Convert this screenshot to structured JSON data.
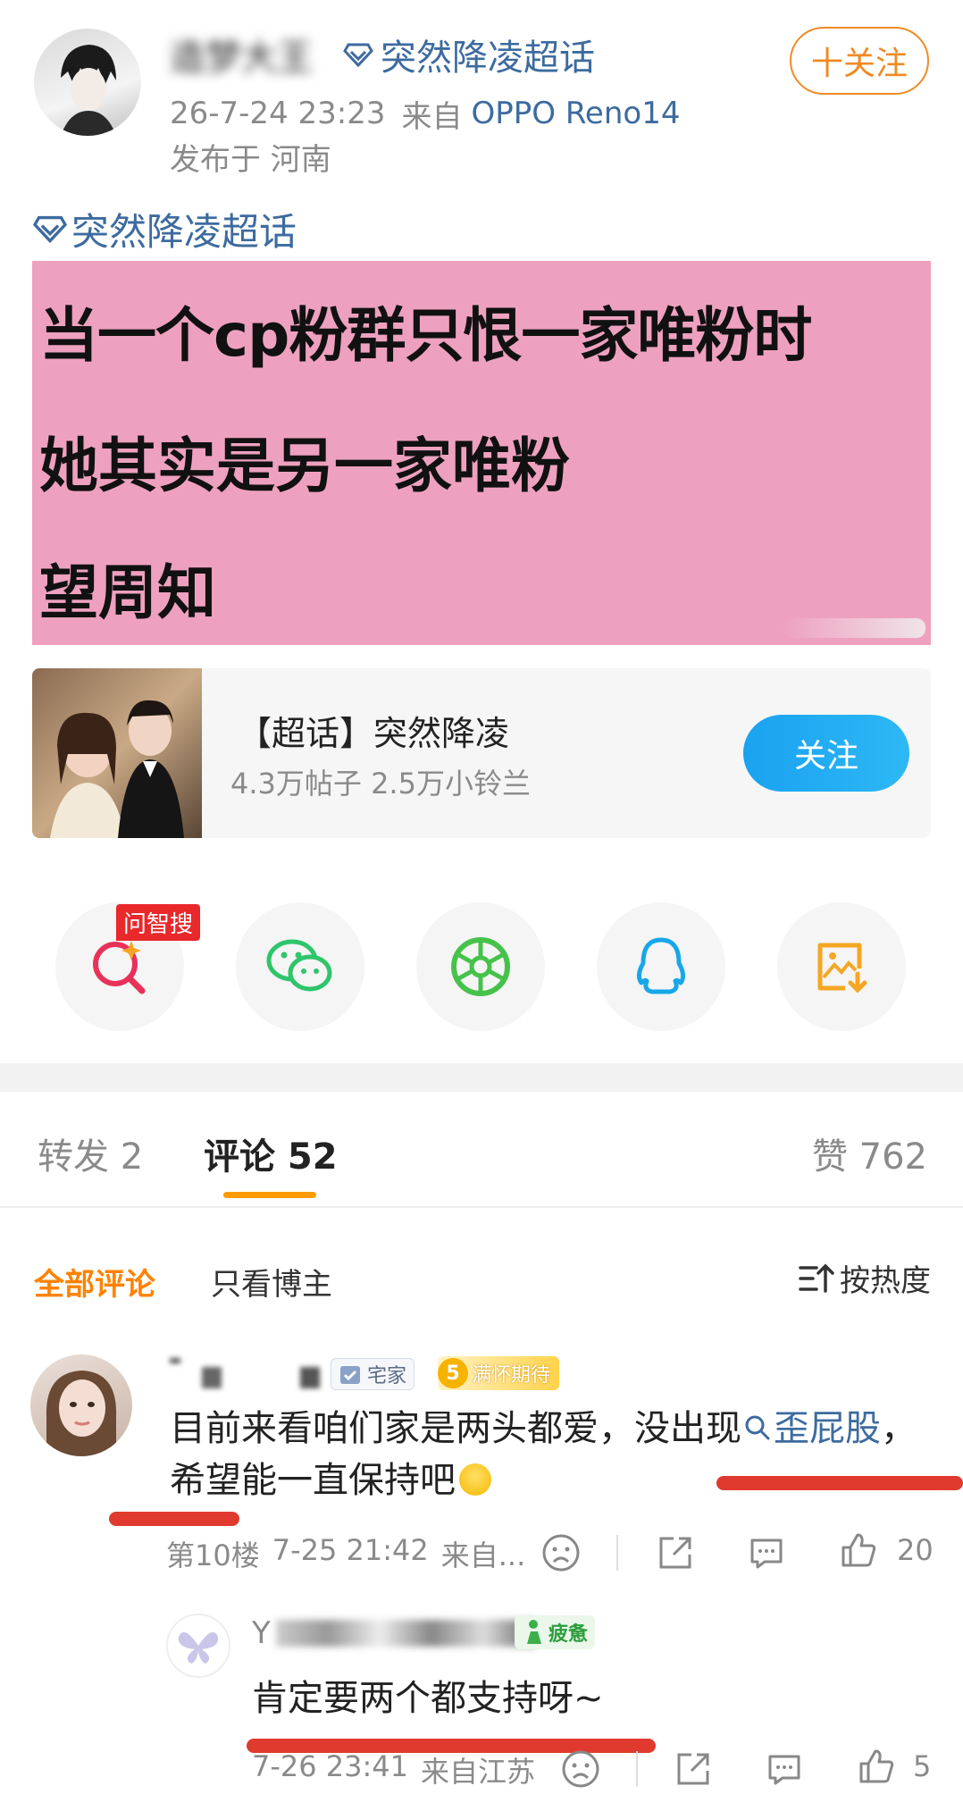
{
  "post": {
    "username": "造梦大王",
    "supertopic_tag": "突然降凌超话",
    "time": "26-7-24 23:23",
    "source_prefix": "来自",
    "device": "OPPO Reno14",
    "location": "发布于 河南",
    "follow_label": "十关注",
    "topic_link": "突然降凌超话",
    "image_lines": [
      "当一个cp粉群只恨一家唯粉时",
      "她其实是另一家唯粉",
      "望周知"
    ]
  },
  "topic_card": {
    "title": "【超话】突然降凌",
    "stats": "4.3万帖子 2.5万小铃兰",
    "follow_label": "关注"
  },
  "share": {
    "search_badge": "问智搜",
    "items": [
      "search-icon",
      "wechat-icon",
      "moments-icon",
      "qq-icon",
      "save-image-icon"
    ]
  },
  "tabs": {
    "repost": "转发 2",
    "comments": "评论 52",
    "likes": "赞 762"
  },
  "filter": {
    "all": "全部评论",
    "author_only": "只看博主",
    "sort": "按热度"
  },
  "comment1": {
    "badge_home": "宅家",
    "badge_level": "5",
    "badge_mood": "满怀期待",
    "text_a": "目前来看咱们家是两头都爱，没出现",
    "link": "歪屁股",
    "text_b": "，希望能一直保持吧",
    "floor": "第10楼",
    "time": "7-25 21:42",
    "source": "来自...",
    "like_count": "20"
  },
  "reply1": {
    "name_prefix": "Y",
    "badge_mood": "疲惫",
    "text": "肯定要两个都支持呀~",
    "time": "7-26 23:41",
    "source": "来自江苏",
    "like_count": "5"
  },
  "colors": {
    "accent_orange": "#ff8200",
    "link_blue": "#3d6b9f",
    "follow_blue": "#1da1f2",
    "pink_bg": "#eea1bf",
    "underline_red": "#e03a2e"
  }
}
